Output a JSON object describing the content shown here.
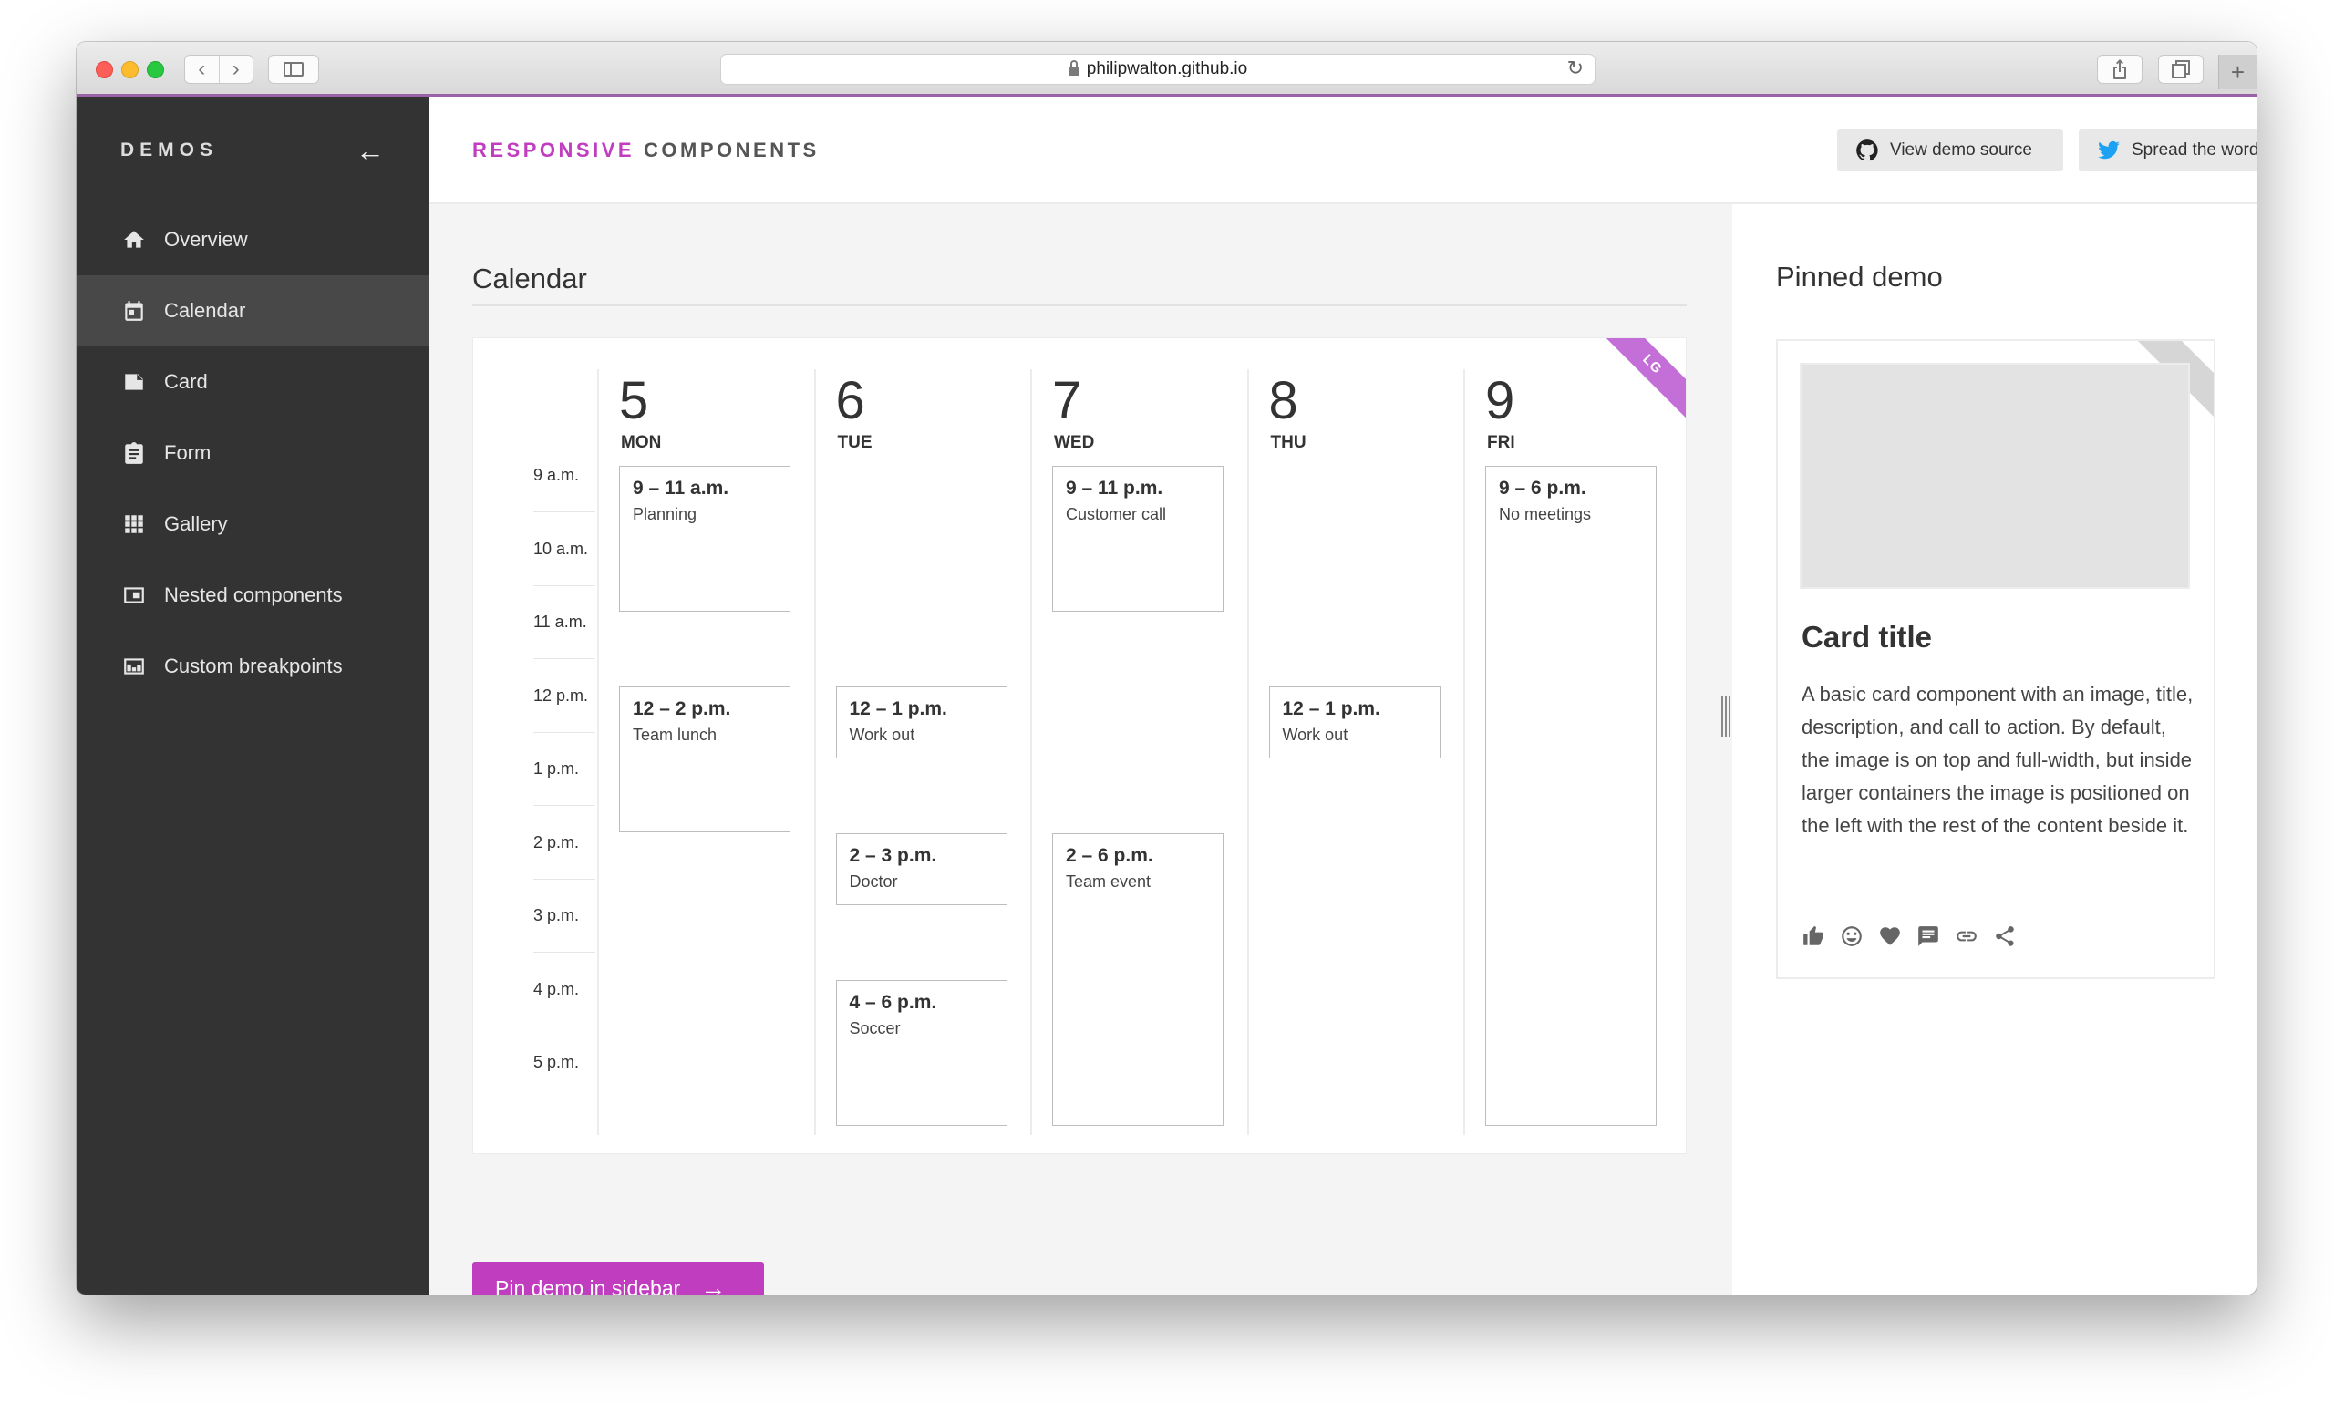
{
  "browser": {
    "url": "philipwalton.github.io",
    "nav_back": "‹",
    "nav_forward": "›",
    "reload": "↻",
    "new_tab": "+"
  },
  "sidebar": {
    "title": "DEMOS",
    "back": "←",
    "items": [
      {
        "label": "Overview",
        "icon": "home-icon"
      },
      {
        "label": "Calendar",
        "icon": "calendar-icon"
      },
      {
        "label": "Card",
        "icon": "card-icon"
      },
      {
        "label": "Form",
        "icon": "clipboard-icon"
      },
      {
        "label": "Gallery",
        "icon": "grid-icon"
      },
      {
        "label": "Nested components",
        "icon": "nested-icon"
      },
      {
        "label": "Custom breakpoints",
        "icon": "breakpoints-icon"
      }
    ]
  },
  "header": {
    "brand_part1": "RESPONSIVE",
    "brand_part2": "COMPONENTS",
    "view_source": "View demo source",
    "spread": "Spread the word"
  },
  "main": {
    "section_title": "Calendar",
    "ribbon": "LG",
    "times": [
      "9 a.m.",
      "10 a.m.",
      "11 a.m.",
      "12 p.m.",
      "1 p.m.",
      "2 p.m.",
      "3 p.m.",
      "4 p.m.",
      "5 p.m."
    ],
    "days": [
      {
        "num": "5",
        "name": "MON",
        "events": [
          {
            "time": "9 – 11 a.m.",
            "desc": "Planning",
            "start": 0,
            "hours": 2
          },
          {
            "time": "12 – 2 p.m.",
            "desc": "Team lunch",
            "start": 3,
            "hours": 2
          }
        ]
      },
      {
        "num": "6",
        "name": "TUE",
        "events": [
          {
            "time": "12 – 1 p.m.",
            "desc": "Work out",
            "start": 3,
            "hours": 1
          },
          {
            "time": "2 – 3 p.m.",
            "desc": "Doctor",
            "start": 5,
            "hours": 1
          },
          {
            "time": "4 – 6 p.m.",
            "desc": "Soccer",
            "start": 7,
            "hours": 2
          }
        ]
      },
      {
        "num": "7",
        "name": "WED",
        "events": [
          {
            "time": "9 – 11 p.m.",
            "desc": "Customer call",
            "start": 0,
            "hours": 2
          },
          {
            "time": "2 – 6 p.m.",
            "desc": "Team event",
            "start": 5,
            "hours": 4
          }
        ]
      },
      {
        "num": "8",
        "name": "THU",
        "events": [
          {
            "time": "12 – 1 p.m.",
            "desc": "Work out",
            "start": 3,
            "hours": 1
          }
        ]
      },
      {
        "num": "9",
        "name": "FRI",
        "events": [
          {
            "time": "9 – 6 p.m.",
            "desc": "No meetings",
            "start": 0,
            "hours": 9
          }
        ]
      }
    ],
    "pin_button": "Pin demo in sidebar",
    "pin_arrow": "→"
  },
  "pinned": {
    "title": "Pinned demo",
    "close": "✕",
    "card_title": "Card title",
    "card_desc": "A basic card component with an image, title, description, and call to action. By default, the image is on top and full-width, but inside larger containers the image is positioned on the left with the rest of the content beside it.",
    "card_icons": [
      "thumbs-up-icon",
      "smiley-icon",
      "heart-icon",
      "comment-icon",
      "link-icon",
      "share-icon"
    ]
  },
  "colors": {
    "accent": "#c13dbf",
    "sidebar_bg": "#333333",
    "ribbon": "#c46ed8"
  }
}
